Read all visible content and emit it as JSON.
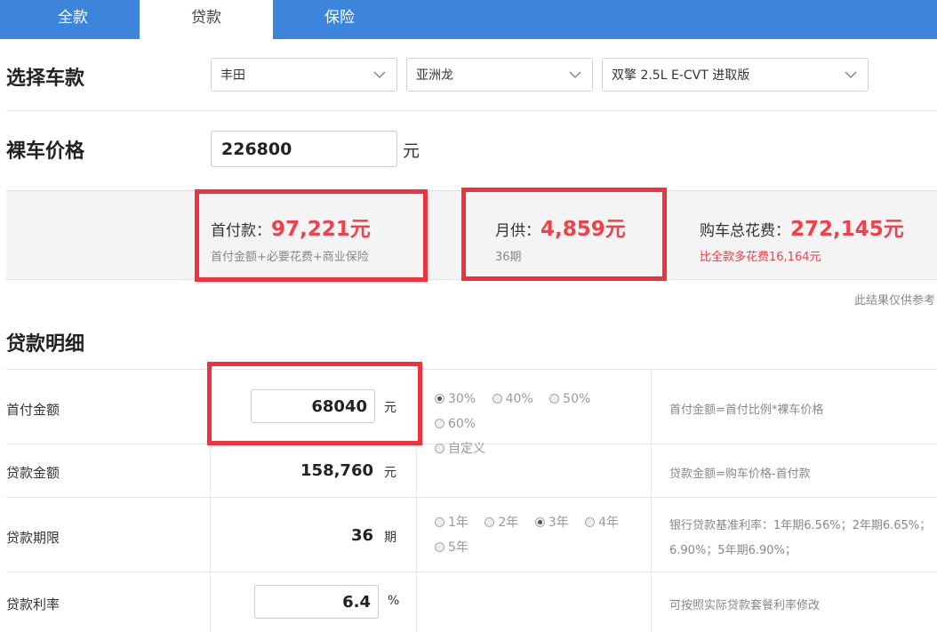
{
  "tabs": [
    {
      "label": "全款",
      "active": false
    },
    {
      "label": "贷款",
      "active": true
    },
    {
      "label": "保险",
      "active": false
    }
  ],
  "select_car": {
    "title": "选择车款",
    "brand": "丰田",
    "series": "亚洲龙",
    "model": "双擎 2.5L E-CVT 进取版"
  },
  "bare_price": {
    "title": "裸车价格",
    "value": "226800",
    "unit": "元"
  },
  "summary": {
    "down_payment": {
      "label": "首付款：",
      "value": "97,221元",
      "sub": "首付金额+必要花费+商业保险"
    },
    "monthly": {
      "label": "月供：",
      "value": "4,859元",
      "sub": "36期"
    },
    "total": {
      "label": "购车总花费：",
      "value": "272,145元",
      "sub": "比全款多花费16,164元"
    },
    "note": "此结果仅供参考"
  },
  "loan_detail": {
    "title": "贷款明细",
    "rows": [
      {
        "label": "首付金额",
        "value": "68040",
        "unit": "元",
        "options": [
          "30%",
          "40%",
          "50%",
          "60%",
          "自定义"
        ],
        "selected": "30%",
        "hint": "首付金额=首付比例*裸车价格"
      },
      {
        "label": "贷款金额",
        "value": "158,760",
        "unit": "元",
        "hint": "贷款金额=购车价格-首付款"
      },
      {
        "label": "贷款期限",
        "value": "36",
        "unit": "期",
        "options": [
          "1年",
          "2年",
          "3年",
          "4年",
          "5年"
        ],
        "selected": "3年",
        "hint_line1": "银行贷款基准利率：1年期6.56%；2年期6.65%；",
        "hint_line2": "6.90%；5年期6.90%；"
      },
      {
        "label": "贷款利率",
        "value": "6.4",
        "unit": "%",
        "hint": "可按照实际贷款套餐利率修改"
      }
    ]
  },
  "colors": {
    "tab_bar": "#3d84db",
    "highlight_red": "#f0414a",
    "annotation_box": "#f0313e"
  }
}
